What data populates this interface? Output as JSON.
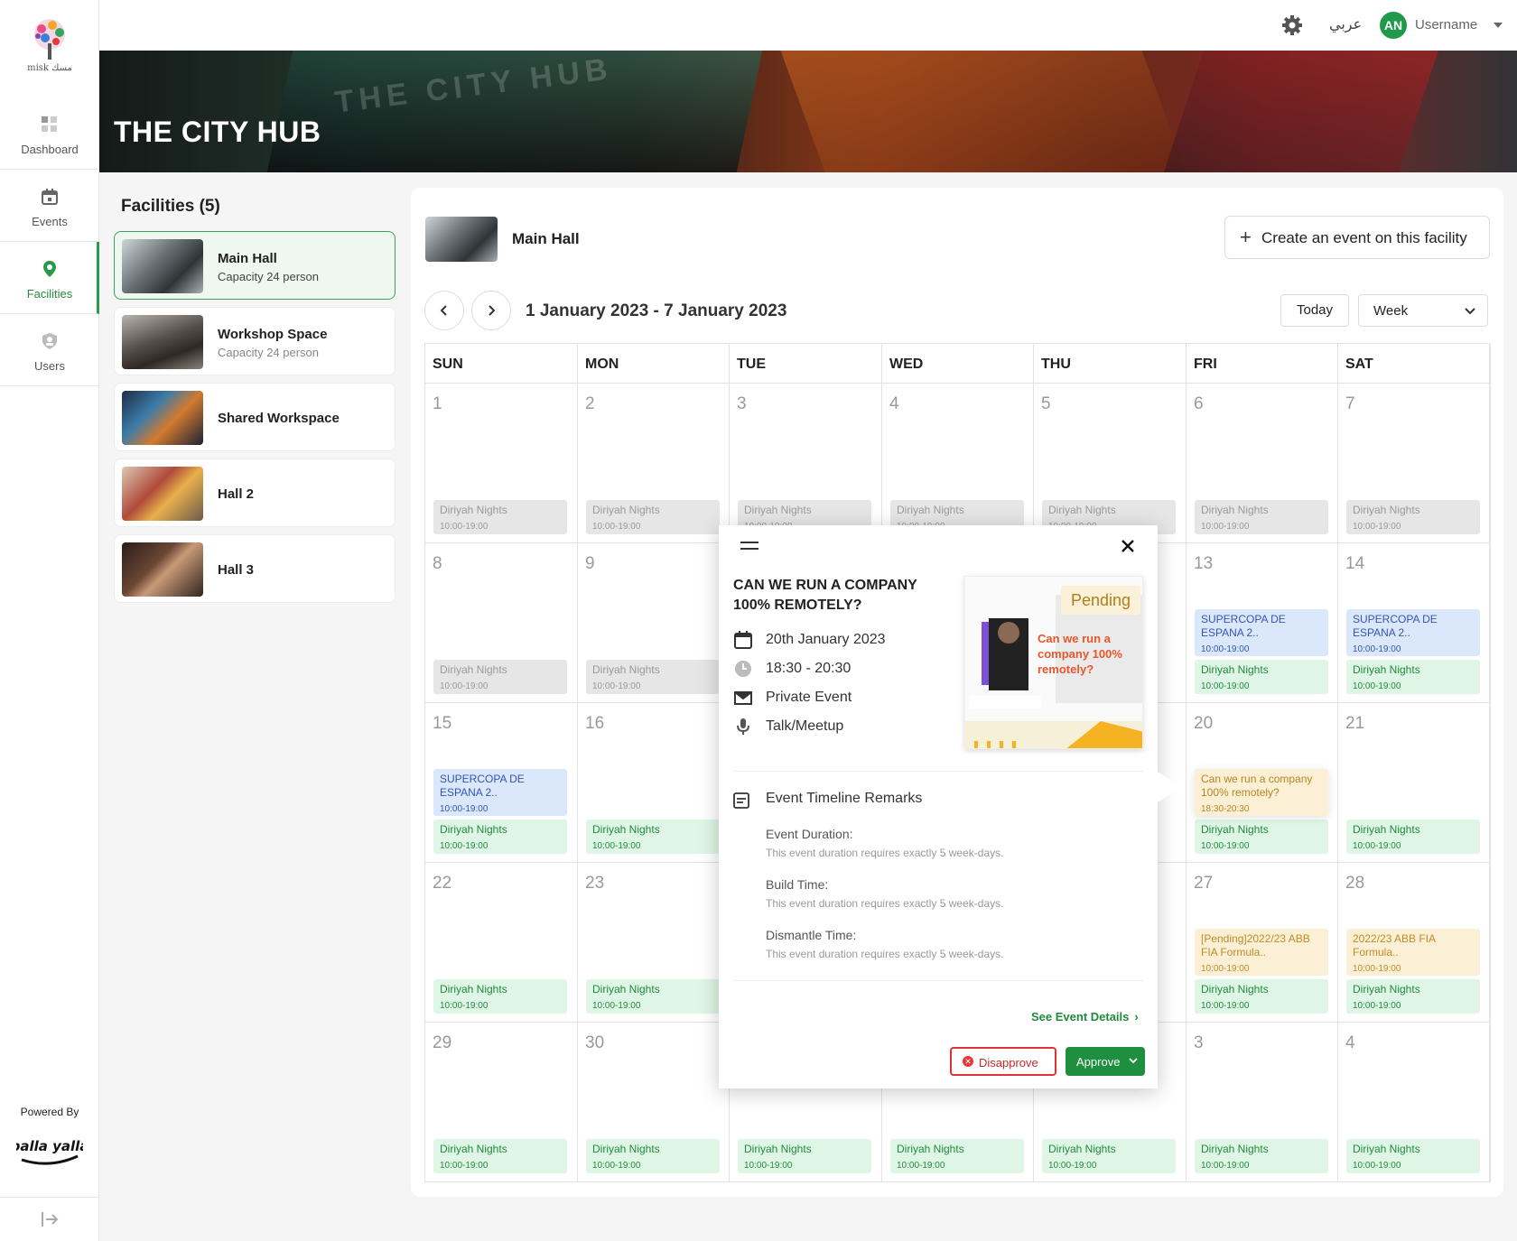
{
  "app": {
    "brand_text": "misk مسك",
    "powered_by": "Powered By",
    "brand_logo_text": "balla yalla"
  },
  "sidebar": {
    "items": [
      {
        "label": "Dashboard",
        "icon": "dashboard-icon"
      },
      {
        "label": "Events",
        "icon": "calendar-icon"
      },
      {
        "label": "Facilities",
        "icon": "location-pin-icon",
        "active": true
      },
      {
        "label": "Users",
        "icon": "user-shield-icon"
      }
    ]
  },
  "header": {
    "language": "عربي",
    "avatar_initials": "AN",
    "username": "Username"
  },
  "hero": {
    "title": "THE CITY HUB",
    "sign_text": "THE CITY HUB"
  },
  "facilities": {
    "title": "Facilities (5)",
    "items": [
      {
        "name": "Main Hall",
        "capacity": "Capacity 24 person",
        "active": true
      },
      {
        "name": "Workshop Space",
        "capacity": "Capacity 24 person"
      },
      {
        "name": "Shared Workspace",
        "capacity": ""
      },
      {
        "name": "Hall 2",
        "capacity": ""
      },
      {
        "name": "Hall 3",
        "capacity": ""
      }
    ]
  },
  "panel": {
    "facility_name": "Main Hall",
    "create_label": "Create an event on this facility",
    "range": "1 January 2023 - 7 January 2023",
    "today": "Today",
    "view": "Week"
  },
  "calendar": {
    "days": [
      "SUN",
      "MON",
      "TUE",
      "WED",
      "THU",
      "FRI",
      "SAT"
    ],
    "weeks": [
      [
        {
          "num": "1",
          "events": [
            {
              "title": "Diriyah Nights",
              "time": "10:00-19:00",
              "color": "gray"
            }
          ]
        },
        {
          "num": "2",
          "events": [
            {
              "title": "Diriyah Nights",
              "time": "10:00-19:00",
              "color": "gray"
            }
          ]
        },
        {
          "num": "3",
          "events": [
            {
              "title": "Diriyah Nights",
              "time": "10:00-19:00",
              "color": "gray"
            }
          ]
        },
        {
          "num": "4",
          "events": [
            {
              "title": "Diriyah Nights",
              "time": "10:00-19:00",
              "color": "gray"
            }
          ]
        },
        {
          "num": "5",
          "events": [
            {
              "title": "Diriyah Nights",
              "time": "10:00-19:00",
              "color": "gray"
            }
          ]
        },
        {
          "num": "6",
          "events": [
            {
              "title": "Diriyah Nights",
              "time": "10:00-19:00",
              "color": "gray"
            }
          ]
        },
        {
          "num": "7",
          "events": [
            {
              "title": "Diriyah Nights",
              "time": "10:00-19:00",
              "color": "gray"
            }
          ]
        }
      ],
      [
        {
          "num": "8",
          "events": [
            {
              "title": "Diriyah Nights",
              "time": "10:00-19:00",
              "color": "gray"
            }
          ]
        },
        {
          "num": "9",
          "events": [
            {
              "title": "Diriyah Nights",
              "time": "10:00-19:00",
              "color": "gray"
            }
          ]
        },
        {
          "num": "",
          "events": []
        },
        {
          "num": "",
          "events": []
        },
        {
          "num": "",
          "events": []
        },
        {
          "num": "13",
          "events": [
            {
              "title": "SUPERCOPA DE ESPANA 2..",
              "time": "10:00-19:00",
              "color": "blue"
            },
            {
              "title": "Diriyah Nights",
              "time": "10:00-19:00",
              "color": "green"
            }
          ]
        },
        {
          "num": "14",
          "events": [
            {
              "title": "SUPERCOPA DE ESPANA 2..",
              "time": "10:00-19:00",
              "color": "blue"
            },
            {
              "title": "Diriyah Nights",
              "time": "10:00-19:00",
              "color": "green"
            }
          ]
        }
      ],
      [
        {
          "num": "15",
          "events": [
            {
              "title": "SUPERCOPA DE ESPANA 2..",
              "time": "10:00-19:00",
              "color": "blue"
            },
            {
              "title": "Diriyah Nights",
              "time": "10:00-19:00",
              "color": "green"
            }
          ]
        },
        {
          "num": "16",
          "events": [
            {
              "title": "Diriyah Nights",
              "time": "10:00-19:00",
              "color": "green"
            }
          ]
        },
        {
          "num": "",
          "events": []
        },
        {
          "num": "",
          "events": []
        },
        {
          "num": "",
          "events": []
        },
        {
          "num": "20",
          "events": [
            {
              "title": "Can we run a company 100% remotely?",
              "time": "18:30-20:30",
              "color": "tip"
            },
            {
              "title": "Diriyah Nights",
              "time": "10:00-19:00",
              "color": "green"
            }
          ]
        },
        {
          "num": "21",
          "events": [
            {
              "title": "Diriyah Nights",
              "time": "10:00-19:00",
              "color": "green"
            }
          ]
        }
      ],
      [
        {
          "num": "22",
          "events": [
            {
              "title": "Diriyah Nights",
              "time": "10:00-19:00",
              "color": "green"
            }
          ]
        },
        {
          "num": "23",
          "events": [
            {
              "title": "Diriyah Nights",
              "time": "10:00-19:00",
              "color": "green"
            }
          ]
        },
        {
          "num": "",
          "events": []
        },
        {
          "num": "",
          "events": []
        },
        {
          "num": "",
          "events": []
        },
        {
          "num": "27",
          "events": [
            {
              "title": "[Pending]2022/23 ABB FIA Formula..",
              "time": "10:00-19:00",
              "color": "yellow"
            },
            {
              "title": "Diriyah Nights",
              "time": "10:00-19:00",
              "color": "green"
            }
          ]
        },
        {
          "num": "28",
          "events": [
            {
              "title": "2022/23 ABB FIA Formula..",
              "time": "10:00-19:00",
              "color": "yellow"
            },
            {
              "title": "Diriyah Nights",
              "time": "10:00-19:00",
              "color": "green"
            }
          ]
        }
      ],
      [
        {
          "num": "29",
          "events": [
            {
              "title": "Diriyah Nights",
              "time": "10:00-19:00",
              "color": "green"
            }
          ]
        },
        {
          "num": "30",
          "events": [
            {
              "title": "Diriyah Nights",
              "time": "10:00-19:00",
              "color": "green"
            }
          ]
        },
        {
          "num": "",
          "events": [
            {
              "title": "Diriyah Nights",
              "time": "10:00-19:00",
              "color": "green"
            }
          ]
        },
        {
          "num": "",
          "events": [
            {
              "title": "Diriyah Nights",
              "time": "10:00-19:00",
              "color": "green"
            }
          ]
        },
        {
          "num": "",
          "events": [
            {
              "title": "Diriyah Nights",
              "time": "10:00-19:00",
              "color": "green"
            }
          ]
        },
        {
          "num": "3",
          "events": [
            {
              "title": "Diriyah Nights",
              "time": "10:00-19:00",
              "color": "green"
            }
          ]
        },
        {
          "num": "4",
          "events": [
            {
              "title": "Diriyah Nights",
              "time": "10:00-19:00",
              "color": "green"
            }
          ]
        }
      ]
    ]
  },
  "popup": {
    "title": "CAN WE RUN A COMPANY 100% REMOTELY?",
    "date": "20th January 2023",
    "time": "18:30 - 20:30",
    "privacy": "Private Event",
    "category": "Talk/Meetup",
    "status": "Pending",
    "poster_text": "Can we run a company 100% remotely?",
    "remarks_title": "Event Timeline Remarks",
    "remarks": [
      {
        "label": "Event Duration:",
        "text": "This event duration requires exactly 5 week-days."
      },
      {
        "label": "Build Time:",
        "text": "This event duration requires exactly 5 week-days."
      },
      {
        "label": "Dismantle Time:",
        "text": "This event duration requires exactly 5 week-days."
      }
    ],
    "see_details": "See Event Details",
    "disapprove": "Disapprove",
    "approve": "Approve"
  }
}
